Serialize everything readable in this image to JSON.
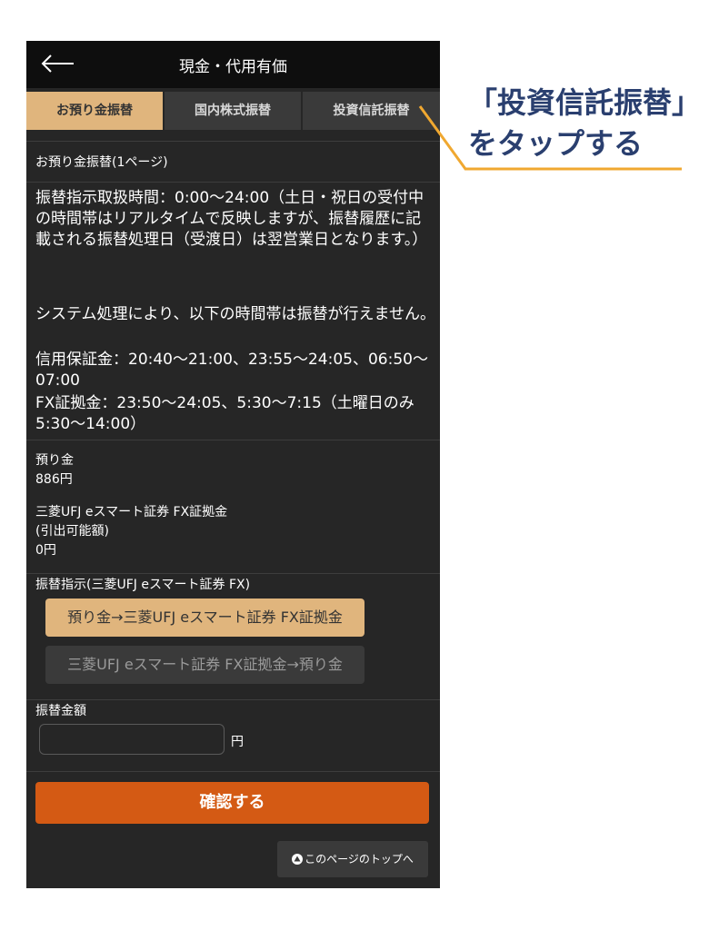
{
  "header": {
    "title": "現金・代用有価"
  },
  "tabs": [
    {
      "label": "お預り金振替",
      "active": true
    },
    {
      "label": "国内株式振替",
      "active": false
    },
    {
      "label": "投資信託振替",
      "active": false
    }
  ],
  "section_title": "お預り金振替(1ページ)",
  "notice": {
    "para1": "振替指示取扱時間：0:00〜24:00（土日・祝日の受付中の時間帯はリアルタイムで反映しますが、振替履歴に記載される振替処理日（受渡日）は翌営業日となります。）",
    "para2": "システム処理により、以下の時間帯は振替が行えません。",
    "para3": "信用保証金：20:40〜21:00、23:55〜24:05、06:50〜07:00",
    "para4": "FX証拠金：23:50〜24:05、5:30〜7:15（土曜日のみ5:30〜14:00）"
  },
  "deposit": {
    "label": "預り金",
    "value": "886円"
  },
  "fx_margin": {
    "label1": "三菱UFJ eスマート証券 FX証拠金",
    "label2": "(引出可能額)",
    "value": "0円"
  },
  "transfer_direction": {
    "label": "振替指示(三菱UFJ eスマート証券 FX)",
    "option_to_fx": "預り金→三菱UFJ eスマート証券 FX証拠金",
    "option_from_fx": "三菱UFJ eスマート証券 FX証拠金→預り金"
  },
  "amount": {
    "label": "振替金額",
    "value": "",
    "unit": "円"
  },
  "confirm_button": "確認する",
  "to_top_link": "このページのトップへ",
  "callout": {
    "line1": "「投資信託振替」",
    "line2": "をタップする"
  },
  "colors": {
    "accent": "#e0b57d",
    "confirm": "#d45a14",
    "callout_text": "#2a3f6f",
    "callout_line": "#f0a830"
  }
}
